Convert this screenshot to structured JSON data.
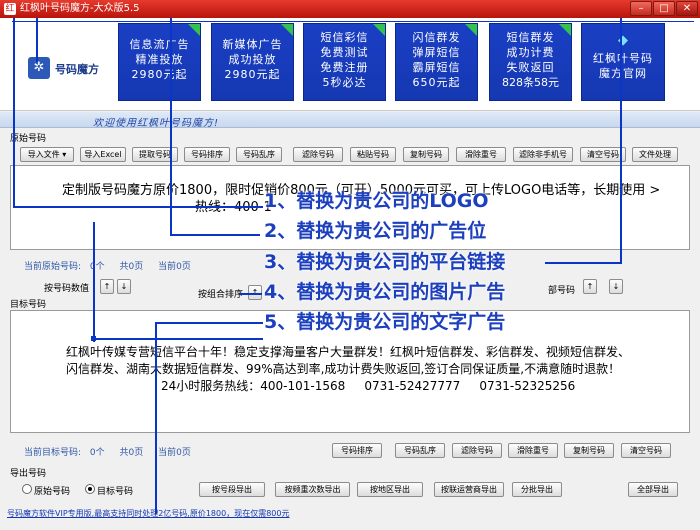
{
  "window": {
    "title": "红枫叶号码魔方-大众版5.5",
    "icon": "红"
  },
  "logo": {
    "text": "号码魔方",
    "icon": "maple-leaf-icon"
  },
  "ads": [
    {
      "lines": [
        "信息流广告",
        "精准投放",
        "2980元起"
      ]
    },
    {
      "lines": [
        "新媒体广告",
        "成功投放",
        "2980元起"
      ]
    },
    {
      "lines": [
        "短信彩信",
        "免费测试",
        "免费注册",
        "5秒必达"
      ]
    },
    {
      "lines": [
        "闪信群发",
        "弹屏短信",
        "霸屏短信",
        "650元起"
      ]
    },
    {
      "lines": [
        "短信群发",
        "成功计费",
        "失败返回",
        "828条58元"
      ]
    },
    {
      "lines": [
        "红枫叶号码",
        "魔方官网"
      ]
    }
  ],
  "welcome": "欢迎使用红枫叶号码魔方!",
  "source": {
    "group_title": "原始号码",
    "buttons": [
      "导入文件 ▾",
      "导入Excel",
      "提取号码",
      "号码排序",
      "号码乱序",
      "滤除号码",
      "粘贴号码",
      "复制号码",
      "滑除重号",
      "滤除非手机号",
      "清空号码",
      "文件处理"
    ],
    "text_lines": [
      "定制版号码魔方原价1800，限时促销价800元（可开）5000元可买，可上传LOGO电话等，长期使用 >",
      "热线：400-1"
    ],
    "status": {
      "label": "当前原始号码:",
      "count": "0个",
      "pages": "共0页",
      "current": "当前0页"
    }
  },
  "combo": {
    "label_1": "按号码数值",
    "label_2": "按组合排序",
    "label_3": "部号码"
  },
  "overlay": {
    "items": [
      "1、替换为贵公司的LOGO",
      "2、替换为贵公司的广告位",
      "3、替换为贵公司的平台链接",
      "4、替换为贵公司的图片广告",
      "5、替换为贵公司的文字广告"
    ]
  },
  "target": {
    "group_title": "目标号码",
    "text_lines": [
      "红枫叶传媒专营短信平台十年！稳定支撑海量客户大量群发！红枫叶短信群发、彩信群发、视频短信群发、",
      "闪信群发、湖南大数据短信群发、99%高达到率,成功计费失败返回,签订合同保证质量,不满意随时退款！",
      "24小时服务热线：400-101-1568     0731-52427777     0731-52325256"
    ],
    "status": {
      "label": "当前目标号码:",
      "count": "0个",
      "pages": "共0页",
      "current": "当前0页"
    },
    "buttons": [
      "号码排序",
      "号码乱序",
      "滤除号码",
      "滑除重号",
      "复制号码",
      "清空号码"
    ]
  },
  "export": {
    "group_title": "导出号码",
    "radio_1": "原始号码",
    "radio_2": "目标号码",
    "buttons": [
      "按号段导出",
      "按频重次数导出",
      "按地区导出",
      "按联运营商导出",
      "分批导出",
      "全部导出"
    ]
  },
  "footer": "号码魔方软件VIP专用版,最高支持同时处理2亿号码,原价1800，现在仅需800元"
}
